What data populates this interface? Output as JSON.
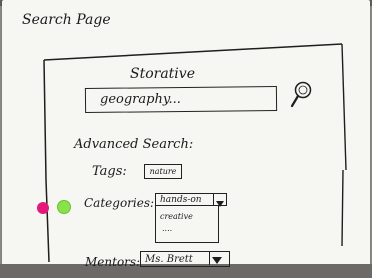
{
  "page_label": "Search Page",
  "app_name": "Storative",
  "search": {
    "value": "geography...",
    "icon": "magnifier-icon"
  },
  "advanced_search_label": "Advanced Search:",
  "tags": {
    "label": "Tags:",
    "chip": "nature"
  },
  "categories": {
    "label": "Categories:",
    "selected": "hands-on",
    "options": [
      "creative",
      "...."
    ]
  },
  "mentors": {
    "label": "Mentors:",
    "selected": "Ms. Brett"
  },
  "colors": {
    "pink_dot": "#e5177a",
    "green_dot": "#88e24a",
    "ink": "#1b1b1b",
    "paper": "#f6f6f3"
  }
}
